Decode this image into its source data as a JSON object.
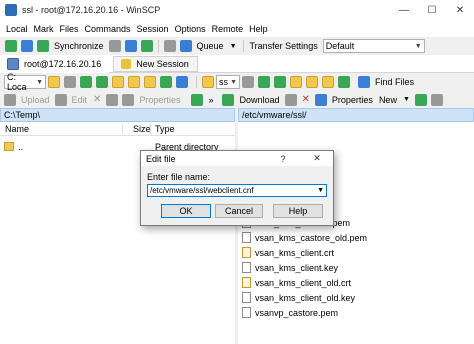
{
  "window": {
    "title": "ssl - root@172.16.20.16 - WinSCP"
  },
  "window_controls": {
    "minimize": "—",
    "maximize": "☐",
    "close": "✕"
  },
  "menu": [
    "Local",
    "Mark",
    "Files",
    "Commands",
    "Session",
    "Options",
    "Remote",
    "Help"
  ],
  "toolbar1": {
    "synchronize": "Synchronize",
    "queue": "Queue",
    "transfer_settings": "Transfer Settings",
    "transfer_profile": "Default"
  },
  "sessions": {
    "active": "root@172.16.20.16",
    "new": "New Session"
  },
  "local_toolbar": {
    "drive": "C: Loca",
    "upload": "Upload",
    "edit": "Edit",
    "properties": "Properties"
  },
  "remote_toolbar": {
    "dir": "ss",
    "find_files": "Find Files",
    "download": "Download",
    "properties": "Properties",
    "new": "New"
  },
  "local_panel": {
    "path": "C:\\Temp\\",
    "columns": {
      "name": "Name",
      "size": "Size",
      "type": "Type"
    },
    "rows": [
      {
        "name": "..",
        "size": "",
        "type": "Parent directory"
      }
    ]
  },
  "remote_panel": {
    "path": "/etc/vmware/ssl/",
    "files": [
      "vsan_kms_castore.pem",
      "vsan_kms_castore_old.pem",
      "vsan_kms_client.crt",
      "vsan_kms_client.key",
      "vsan_kms_client_old.crt",
      "vsan_kms_client_old.key",
      "vsanvp_castore.pem"
    ]
  },
  "dialog": {
    "title": "Edit file",
    "help_glyph": "?",
    "close_glyph": "✕",
    "label": "Enter file name:",
    "value": "/etc/vmware/ssl/webclient.cnf",
    "ok": "OK",
    "cancel": "Cancel",
    "help": "Help"
  }
}
